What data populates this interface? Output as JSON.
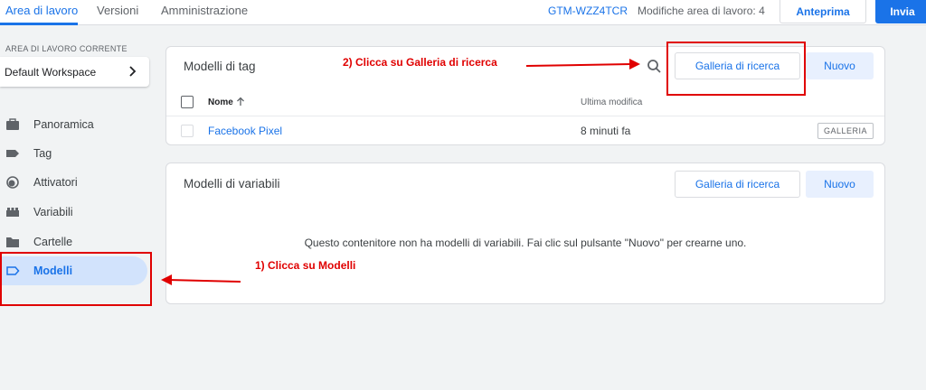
{
  "topbar": {
    "tabs": [
      {
        "label": "Area di lavoro",
        "active": true
      },
      {
        "label": "Versioni",
        "active": false
      },
      {
        "label": "Amministrazione",
        "active": false
      }
    ],
    "container_id": "GTM-WZZ4TCR",
    "changes_label": "Modifiche area di lavoro: 4",
    "preview_label": "Anteprima",
    "submit_label": "Invia"
  },
  "sidebar": {
    "workspace_label": "AREA DI LAVORO CORRENTE",
    "workspace_name": "Default Workspace",
    "items": [
      {
        "label": "Panoramica",
        "icon": "briefcase-icon"
      },
      {
        "label": "Tag",
        "icon": "tag-icon"
      },
      {
        "label": "Attivatori",
        "icon": "trigger-icon"
      },
      {
        "label": "Variabili",
        "icon": "variables-icon"
      },
      {
        "label": "Cartelle",
        "icon": "folder-icon"
      },
      {
        "label": "Modelli",
        "icon": "template-icon",
        "active": true
      }
    ]
  },
  "tag_templates": {
    "title": "Modelli di tag",
    "search_icon": "search-icon",
    "gallery_button": "Galleria di ricerca",
    "new_button": "Nuovo",
    "columns": {
      "name": "Nome",
      "modified": "Ultima modifica"
    },
    "rows": [
      {
        "name": "Facebook Pixel",
        "modified": "8 minuti fa",
        "badge": "GALLERIA"
      }
    ]
  },
  "variable_templates": {
    "title": "Modelli di variabili",
    "gallery_button": "Galleria di ricerca",
    "new_button": "Nuovo",
    "empty_message": "Questo contenitore non ha modelli di variabili. Fai clic sul pulsante \"Nuovo\" per crearne uno."
  },
  "annotations": {
    "step1": "1) Clicca su Modelli",
    "step2": "2) Clicca su Galleria di ricerca",
    "color": "#e00000"
  },
  "colors": {
    "accent": "#1a73e8",
    "active_nav_bg": "#d2e3fc",
    "page_bg": "#f1f3f4"
  }
}
